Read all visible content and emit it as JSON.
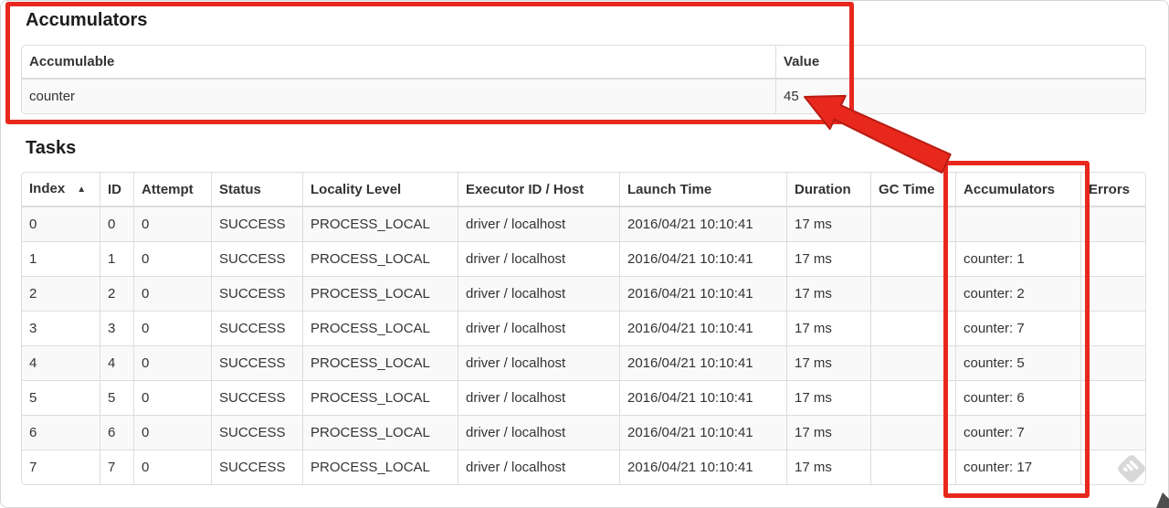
{
  "accumulators_section": {
    "title": "Accumulators",
    "table": {
      "headers": [
        "Accumulable",
        "Value"
      ],
      "rows": [
        [
          "counter",
          "45"
        ]
      ]
    }
  },
  "tasks_section": {
    "title": "Tasks",
    "table": {
      "headers": [
        "Index",
        "ID",
        "Attempt",
        "Status",
        "Locality Level",
        "Executor ID / Host",
        "Launch Time",
        "Duration",
        "GC Time",
        "Accumulators",
        "Errors"
      ],
      "sort_indicator": "▲",
      "rows": [
        [
          "0",
          "0",
          "0",
          "SUCCESS",
          "PROCESS_LOCAL",
          "driver / localhost",
          "2016/04/21 10:10:41",
          "17 ms",
          "",
          "",
          ""
        ],
        [
          "1",
          "1",
          "0",
          "SUCCESS",
          "PROCESS_LOCAL",
          "driver / localhost",
          "2016/04/21 10:10:41",
          "17 ms",
          "",
          "counter: 1",
          ""
        ],
        [
          "2",
          "2",
          "0",
          "SUCCESS",
          "PROCESS_LOCAL",
          "driver / localhost",
          "2016/04/21 10:10:41",
          "17 ms",
          "",
          "counter: 2",
          ""
        ],
        [
          "3",
          "3",
          "0",
          "SUCCESS",
          "PROCESS_LOCAL",
          "driver / localhost",
          "2016/04/21 10:10:41",
          "17 ms",
          "",
          "counter: 7",
          ""
        ],
        [
          "4",
          "4",
          "0",
          "SUCCESS",
          "PROCESS_LOCAL",
          "driver / localhost",
          "2016/04/21 10:10:41",
          "17 ms",
          "",
          "counter: 5",
          ""
        ],
        [
          "5",
          "5",
          "0",
          "SUCCESS",
          "PROCESS_LOCAL",
          "driver / localhost",
          "2016/04/21 10:10:41",
          "17 ms",
          "",
          "counter: 6",
          ""
        ],
        [
          "6",
          "6",
          "0",
          "SUCCESS",
          "PROCESS_LOCAL",
          "driver / localhost",
          "2016/04/21 10:10:41",
          "17 ms",
          "",
          "counter: 7",
          ""
        ],
        [
          "7",
          "7",
          "0",
          "SUCCESS",
          "PROCESS_LOCAL",
          "driver / localhost",
          "2016/04/21 10:10:41",
          "17 ms",
          "",
          "counter: 17",
          ""
        ]
      ]
    }
  },
  "annotations": {
    "highlight_color": "#e8281d"
  }
}
